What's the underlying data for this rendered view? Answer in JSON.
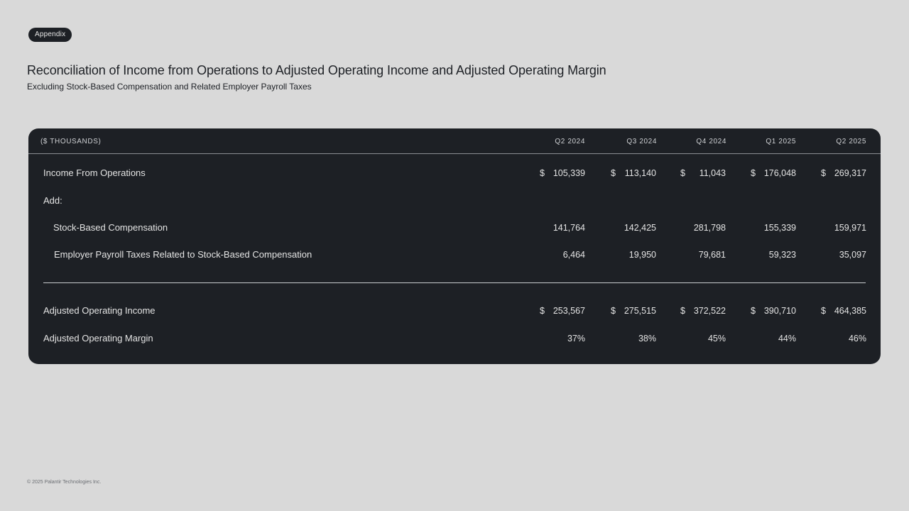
{
  "badge": "Appendix",
  "title": "Reconciliation of Income from Operations to Adjusted Operating Income and Adjusted Operating Margin",
  "subtitle": "Excluding Stock-Based Compensation and Related Employer Payroll Taxes",
  "table": {
    "unit_label": "($ THOUSANDS)",
    "columns": [
      "Q2 2024",
      "Q3 2024",
      "Q4 2024",
      "Q1 2025",
      "Q2 2025"
    ],
    "currency_symbol": "$",
    "rows": {
      "income_from_operations": {
        "label": "Income From Operations",
        "values": [
          "105,339",
          "113,140",
          "11,043",
          "176,048",
          "269,317"
        ]
      },
      "add": {
        "label": "Add:"
      },
      "stock_based_compensation": {
        "label": "Stock-Based Compensation",
        "values": [
          "141,764",
          "142,425",
          "281,798",
          "155,339",
          "159,971"
        ]
      },
      "employer_payroll_taxes": {
        "label": "Employer Payroll Taxes Related to Stock-Based Compensation",
        "values": [
          "6,464",
          "19,950",
          "79,681",
          "59,323",
          "35,097"
        ]
      },
      "adjusted_operating_income": {
        "label": "Adjusted Operating Income",
        "values": [
          "253,567",
          "275,515",
          "372,522",
          "390,710",
          "464,385"
        ]
      },
      "adjusted_operating_margin": {
        "label": "Adjusted Operating Margin",
        "values": [
          "37%",
          "38%",
          "45%",
          "44%",
          "46%"
        ]
      }
    }
  },
  "footer": "© 2025 Palantir Technologies Inc."
}
